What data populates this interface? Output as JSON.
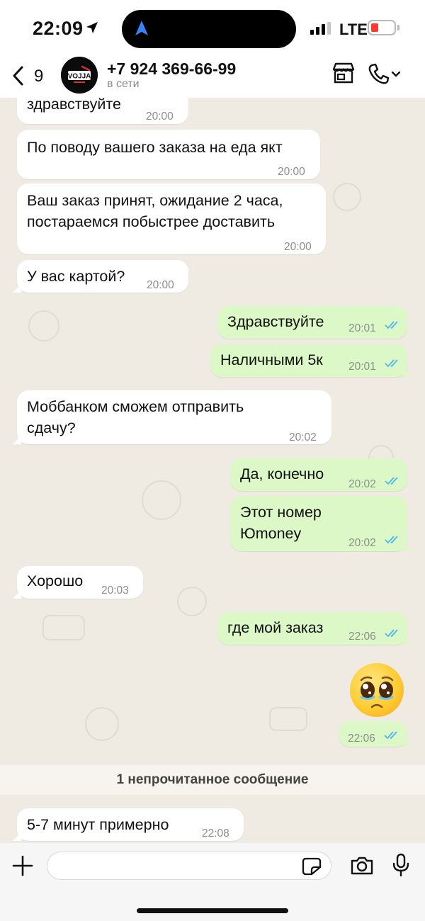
{
  "status_bar": {
    "time": "22:09",
    "network": "LTE",
    "battery_level": 0.15
  },
  "header": {
    "back_count": "9",
    "contact_name": "+7 924 369-66-99",
    "contact_status": "в сети",
    "avatar_text": "VOJJA"
  },
  "messages": [
    {
      "dir": "in",
      "text": "здравствуйте",
      "time": "20:00"
    },
    {
      "dir": "in",
      "text": "По поводу вашего заказа на еда якт",
      "time": "20:00"
    },
    {
      "dir": "in",
      "lines": [
        "Ваш заказ принят, ожидание 2 часа,",
        "постараемся побыстрее доставить"
      ],
      "time": "20:00"
    },
    {
      "dir": "in",
      "text": "У вас картой?",
      "time": "20:00"
    },
    {
      "dir": "out",
      "text": "Здравствуйте",
      "time": "20:01",
      "read": true
    },
    {
      "dir": "out",
      "text": "Наличными 5к",
      "time": "20:01",
      "read": true
    },
    {
      "dir": "in",
      "lines": [
        "Моббанком сможем отправить",
        "сдачу?"
      ],
      "time": "20:02"
    },
    {
      "dir": "out",
      "text": "Да, конечно",
      "time": "20:02",
      "read": true
    },
    {
      "dir": "out",
      "lines": [
        "Этот номер",
        "Юmoney"
      ],
      "time": "20:02",
      "read": true
    },
    {
      "dir": "in",
      "text": "Хорошо",
      "time": "20:03"
    },
    {
      "dir": "out",
      "text": "где мой заказ",
      "time": "22:06",
      "read": true
    },
    {
      "dir": "out",
      "emoji": "pleading-face",
      "time": "22:06",
      "read": true
    },
    {
      "dir": "in",
      "text": "5-7 минут примерно",
      "time": "22:08"
    }
  ],
  "unread_banner": "1 непрочитанное сообщение",
  "input": {
    "placeholder": ""
  },
  "colors": {
    "incoming_bubble": "#ffffff",
    "outgoing_bubble": "#dcf8c6",
    "read_ticks": "#4fb6ec",
    "chat_background": "#efeae2"
  }
}
